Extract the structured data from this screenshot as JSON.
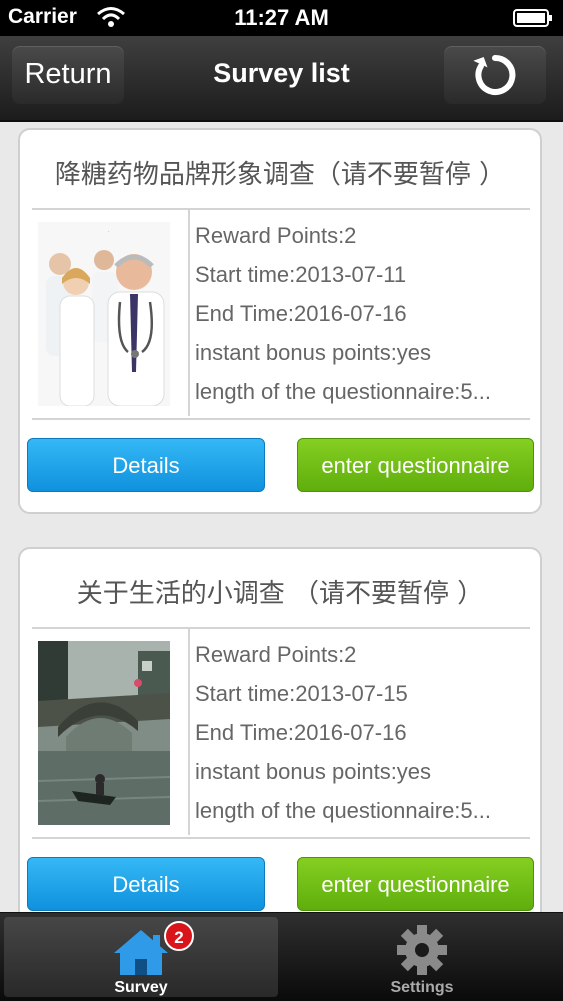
{
  "status_bar": {
    "carrier": "Carrier",
    "time": "11:27 AM"
  },
  "nav": {
    "return_label": "Return",
    "title": "Survey list"
  },
  "surveys": [
    {
      "title": "降糖药物品牌形象调查（请不要暂停 ）",
      "reward": "Reward Points:2",
      "start": "Start time:2013-07-11",
      "end": "End Time:2016-07-16",
      "bonus": "instant bonus points:yes",
      "length": "length of the questionnaire:5...",
      "details_label": "Details",
      "enter_label": "enter questionnaire"
    },
    {
      "title": "关于生活的小调查 （请不要暂停 ）",
      "reward": "Reward Points:2",
      "start": "Start time:2013-07-15",
      "end": "End Time:2016-07-16",
      "bonus": "instant bonus points:yes",
      "length": "length of the questionnaire:5...",
      "details_label": "Details",
      "enter_label": "enter questionnaire"
    }
  ],
  "tabbar": {
    "survey_label": "Survey",
    "survey_badge": "2",
    "settings_label": "Settings"
  },
  "colors": {
    "details_button": "#1ea3ea",
    "enter_button": "#72c018",
    "badge": "#d9141b"
  },
  "icons": [
    "wifi-icon",
    "battery-icon",
    "refresh-icon",
    "home-icon",
    "gear-icon"
  ]
}
